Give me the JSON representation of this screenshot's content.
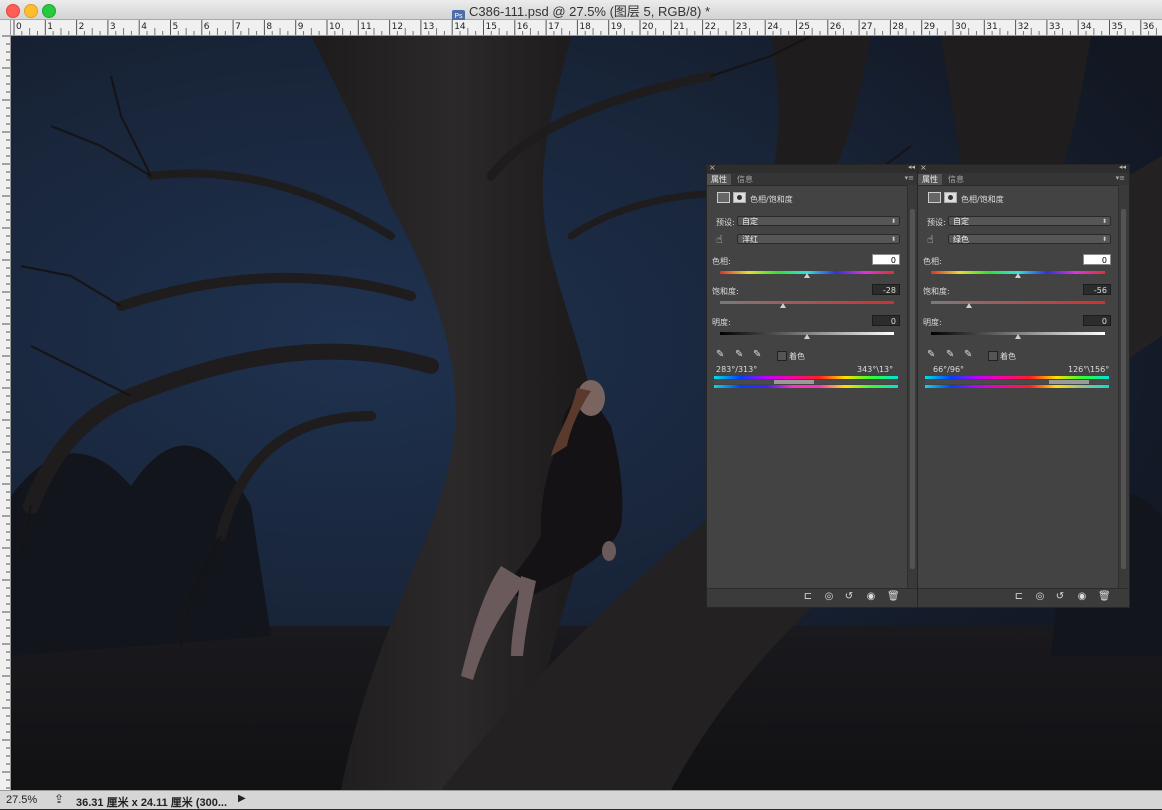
{
  "window": {
    "title": "C386-111.psd @ 27.5% (图层 5, RGB/8) *",
    "traffic_lights": {
      "close": "#ff5f57",
      "minimize": "#febc2e",
      "zoom": "#28c840"
    }
  },
  "ruler": {
    "horizontal_ticks": [
      "0",
      "1",
      "2",
      "3",
      "4",
      "5",
      "6",
      "7",
      "8",
      "9",
      "10",
      "11",
      "12",
      "13",
      "14",
      "15",
      "16",
      "17",
      "18",
      "19",
      "20",
      "21",
      "22",
      "23",
      "24",
      "25",
      "26",
      "27",
      "28",
      "29",
      "30",
      "31",
      "32",
      "33",
      "34",
      "35",
      "36"
    ]
  },
  "panels": [
    {
      "tabs": [
        "属性",
        "信息"
      ],
      "active_tab": 0,
      "adjustment_title": "色相/饱和度",
      "preset_label": "预设:",
      "preset_value": "自定",
      "channel_value": "洋红",
      "hue_label": "色相:",
      "hue_value": "0",
      "saturation_label": "饱和度:",
      "saturation_value": "-28",
      "lightness_label": "明度:",
      "lightness_value": "0",
      "colorize_label": "着色",
      "range_left": "283°/313°",
      "range_right": "343°\\13°",
      "hue_slider_position": 0.5,
      "saturation_slider_position": 0.36,
      "lightness_slider_position": 0.5
    },
    {
      "tabs": [
        "属性",
        "信息"
      ],
      "active_tab": 0,
      "adjustment_title": "色相/饱和度",
      "preset_label": "预设:",
      "preset_value": "自定",
      "channel_value": "绿色",
      "hue_label": "色相:",
      "hue_value": "0",
      "saturation_label": "饱和度:",
      "saturation_value": "-56",
      "lightness_label": "明度:",
      "lightness_value": "0",
      "colorize_label": "着色",
      "range_left": "66°/96°",
      "range_right": "126°\\156°",
      "hue_slider_position": 0.5,
      "saturation_slider_position": 0.22,
      "lightness_slider_position": 0.5
    }
  ],
  "status": {
    "zoom": "27.5%",
    "doc_info": "36.31 厘米 x 24.11 厘米 (300..."
  },
  "icons": {
    "adjustment_layer": "adjustment-layer-icon",
    "mask": "mask-icon",
    "hand_tool": "hand-targeted-adjustment-icon",
    "eyedropper": "eyedropper-icon",
    "eyedropper_add": "eyedropper-plus-icon",
    "eyedropper_subtract": "eyedropper-minus-icon",
    "clip": "clip-to-layer-icon",
    "view_previous": "view-previous-icon",
    "reset": "reset-icon",
    "visibility": "eye-icon",
    "delete": "trash-icon"
  }
}
